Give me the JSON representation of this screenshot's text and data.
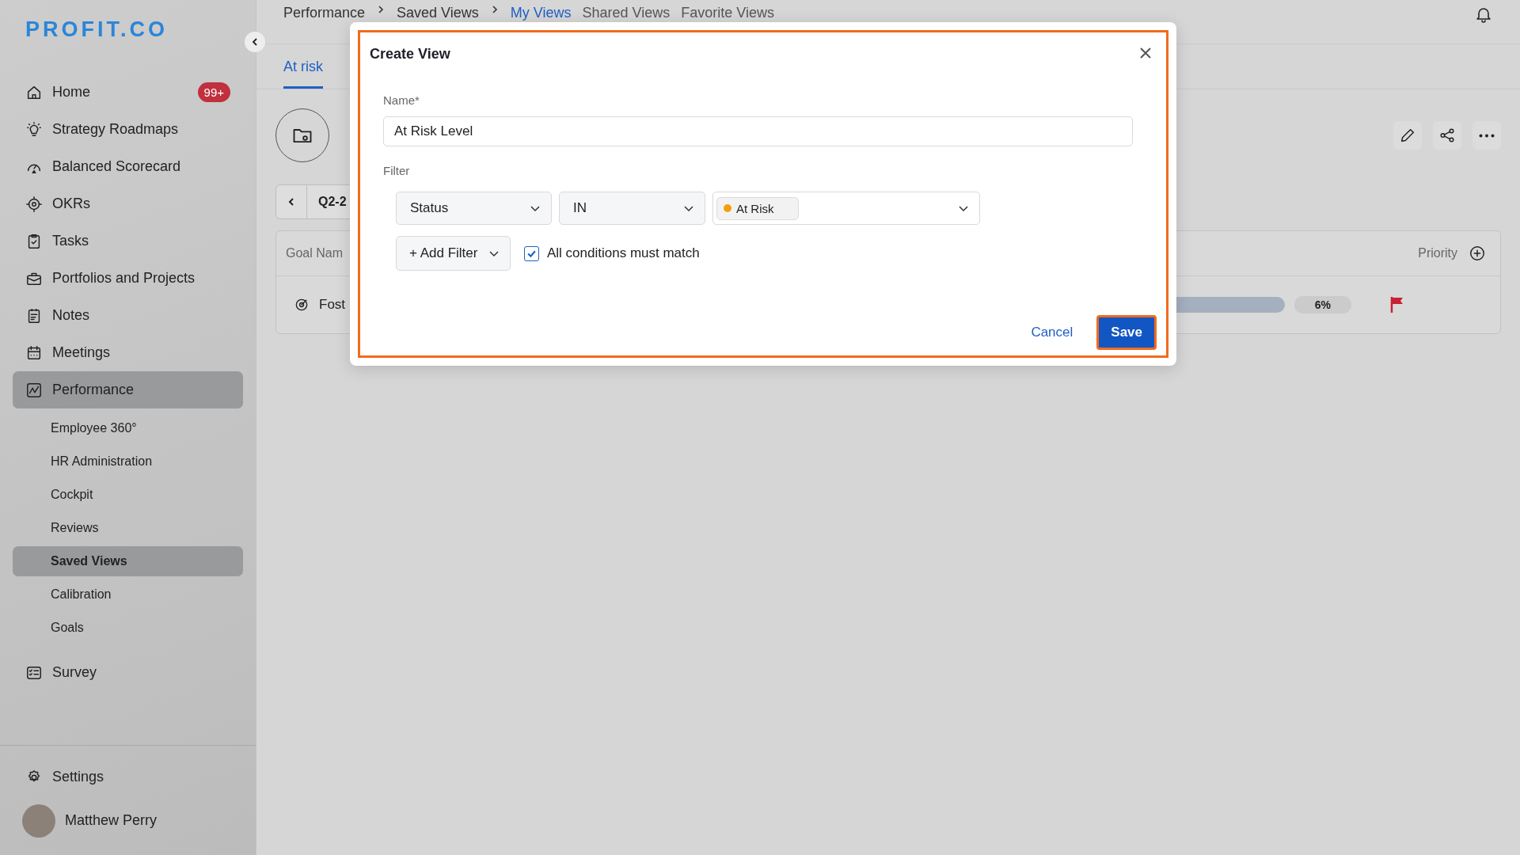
{
  "sidebar": {
    "logo": "PROFIT.CO",
    "items": [
      {
        "label": "Home",
        "badge": "99+",
        "selected": false
      },
      {
        "label": "Strategy Roadmaps",
        "selected": false
      },
      {
        "label": "Balanced Scorecard",
        "selected": false
      },
      {
        "label": "OKRs",
        "selected": false
      },
      {
        "label": "Tasks",
        "selected": false
      },
      {
        "label": "Portfolios and Projects",
        "selected": false
      },
      {
        "label": "Notes",
        "selected": false
      },
      {
        "label": "Meetings",
        "selected": false
      },
      {
        "label": "Performance",
        "selected": true,
        "expanded": true,
        "children": [
          {
            "label": "Employee 360°",
            "selected": false
          },
          {
            "label": "HR Administration",
            "selected": false
          },
          {
            "label": "Cockpit",
            "selected": false
          },
          {
            "label": "Reviews",
            "selected": false
          },
          {
            "label": "Saved Views",
            "selected": true
          },
          {
            "label": "Calibration",
            "selected": false
          },
          {
            "label": "Goals",
            "selected": false
          }
        ]
      },
      {
        "label": "Survey",
        "selected": false
      }
    ],
    "settings": "Settings",
    "user": "Matthew Perry"
  },
  "breadcrumb": [
    {
      "label": "Performance"
    },
    {
      "label": "Saved Views"
    }
  ],
  "view_tabs": [
    {
      "label": "My Views",
      "selected": true
    },
    {
      "label": "Shared Views",
      "selected": false
    },
    {
      "label": "Favorite Views",
      "selected": false
    }
  ],
  "tabs": [
    {
      "label": "At risk",
      "selected": true
    }
  ],
  "period": "Q2-2",
  "table": {
    "columns": [
      "Goal Nam",
      "Priority"
    ],
    "rows": [
      {
        "goal": "Fost",
        "progress": "6%"
      }
    ]
  },
  "dialog": {
    "title": "Create View",
    "name_label": "Name*",
    "name_value": "At Risk Level",
    "filter_label": "Filter",
    "filters": [
      {
        "field": "Status",
        "operator": "IN",
        "values": [
          {
            "label": "At Risk",
            "color": "#f59e0b"
          }
        ]
      }
    ],
    "add_filter": "+ Add Filter",
    "match_all": {
      "label": "All conditions must match",
      "checked": true
    },
    "cancel": "Cancel",
    "save": "Save"
  }
}
